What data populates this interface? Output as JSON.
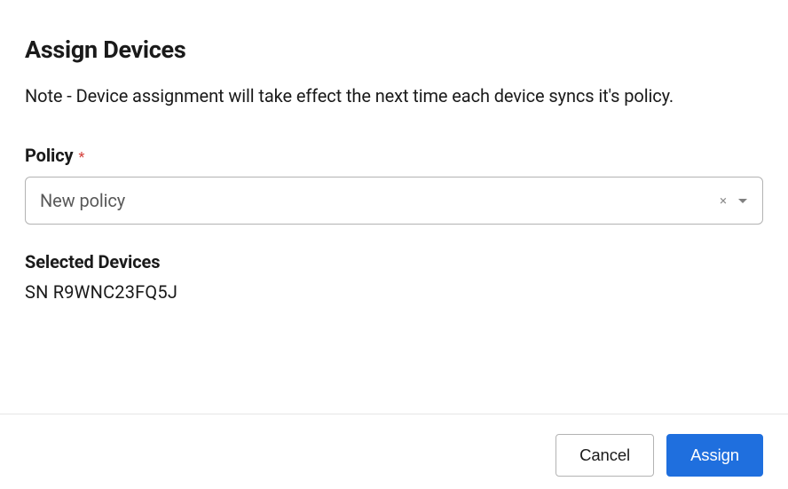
{
  "dialog": {
    "title": "Assign Devices",
    "note": "Note - Device assignment will take effect the next time each device syncs it's policy."
  },
  "policy_field": {
    "label": "Policy",
    "required_marker": "*",
    "selected_value": "New policy"
  },
  "selected_devices": {
    "label": "Selected Devices",
    "items": [
      "SN R9WNC23FQ5J"
    ]
  },
  "footer": {
    "cancel_label": "Cancel",
    "assign_label": "Assign"
  }
}
